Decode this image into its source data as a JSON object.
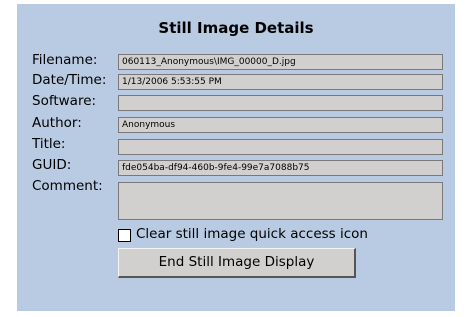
{
  "dialog": {
    "title": "Still Image Details"
  },
  "fields": {
    "filename": {
      "label": "Filename:",
      "value": "060113_Anonymous\\IMG_00000_D.jpg"
    },
    "datetime": {
      "label": "Date/Time:",
      "value": "1/13/2006 5:53:55 PM"
    },
    "software": {
      "label": "Software:",
      "value": ""
    },
    "author": {
      "label": "Author:",
      "value": "Anonymous"
    },
    "title": {
      "label": "Title:",
      "value": ""
    },
    "guid": {
      "label": "GUID:",
      "value": "fde054ba-df94-460b-9fe4-99e7a7088b75"
    },
    "comment": {
      "label": "Comment:",
      "value": ""
    }
  },
  "options": {
    "clear_icon_label": "Clear still image quick access icon",
    "clear_icon_checked": false
  },
  "actions": {
    "end_display_label": "End Still Image Display"
  },
  "colors": {
    "panel_background": "#b9cbe3",
    "field_background": "#d2d0ce"
  }
}
